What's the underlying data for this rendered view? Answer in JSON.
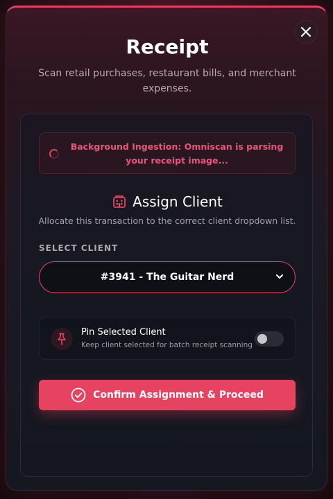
{
  "modal": {
    "title": "Receipt",
    "subtitle": "Scan retail purchases, restaurant bills, and merchant expenses.",
    "close_icon": "close-icon"
  },
  "ingestion": {
    "status_text": "Background Ingestion: Omniscan is parsing your receipt image...",
    "icon": "spinner-icon"
  },
  "assign": {
    "icon": "building-icon",
    "title": "Assign Client",
    "description": "Allocate this transaction to the correct client dropdown list.",
    "select_label": "SELECT CLIENT",
    "selected_value": "#3941 - The Guitar Nerd"
  },
  "pin": {
    "icon": "pin-icon",
    "title": "Pin Selected Client",
    "description": "Keep client selected for batch receipt scanning",
    "enabled": false
  },
  "confirm": {
    "icon": "check-circle-icon",
    "label": "Confirm Assignment & Proceed"
  },
  "colors": {
    "accent": "#e5405e",
    "background": "#151820"
  }
}
